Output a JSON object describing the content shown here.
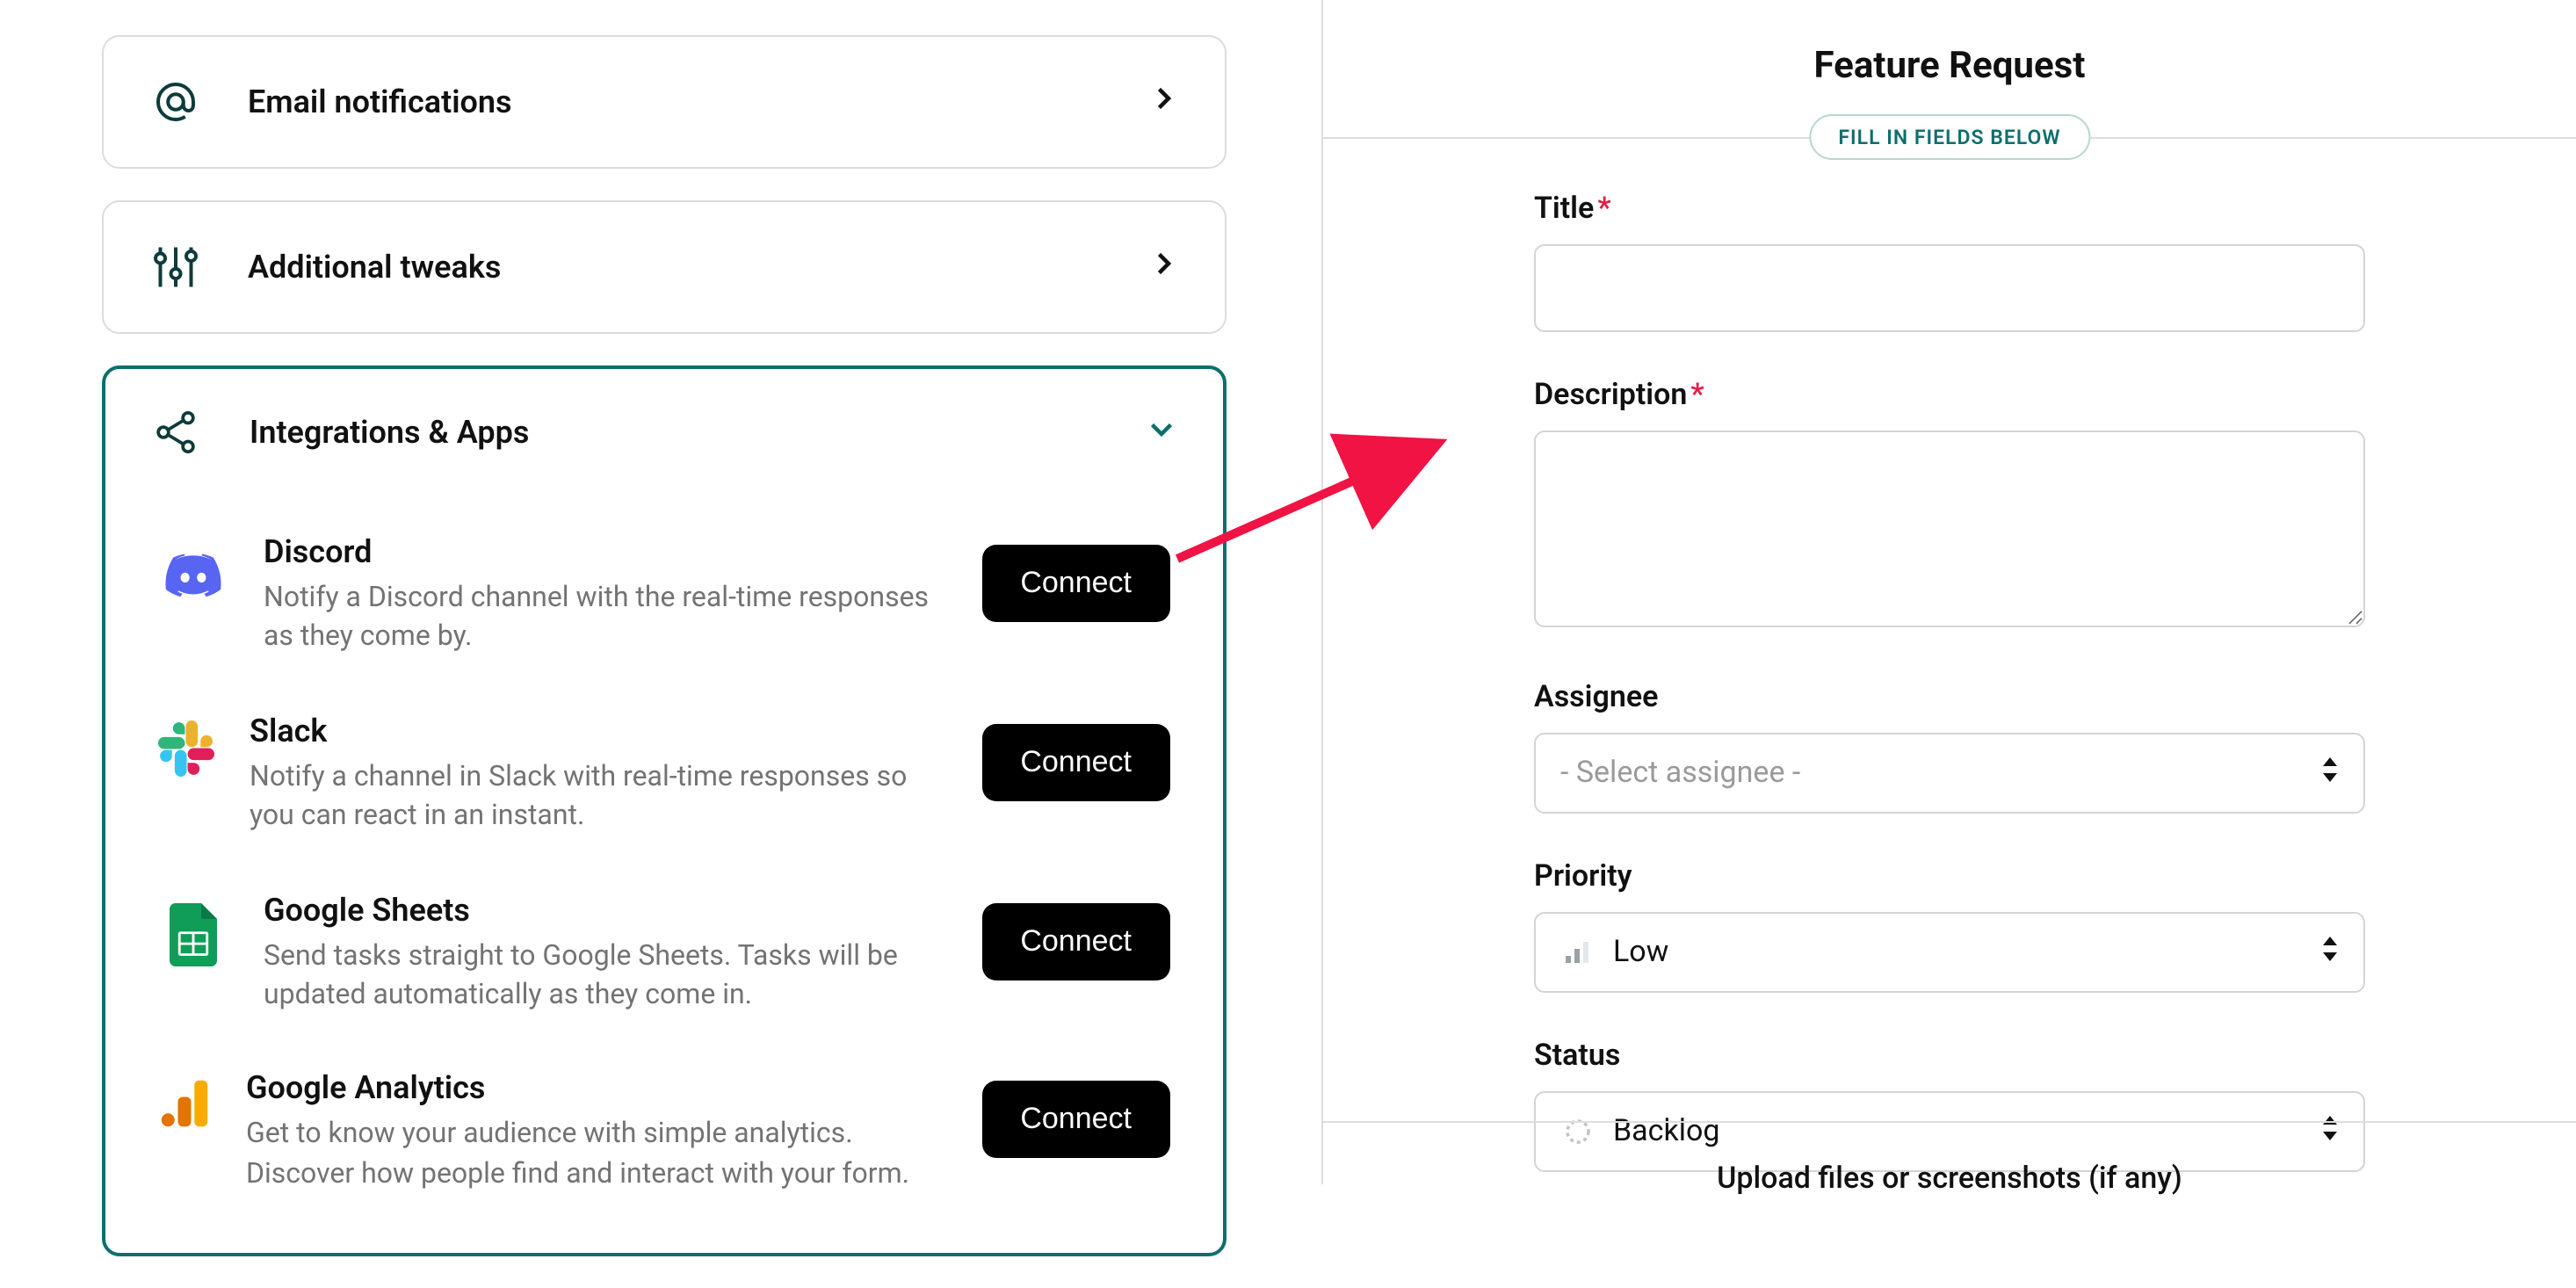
{
  "left": {
    "cards": {
      "email": {
        "title": "Email notifications"
      },
      "tweaks": {
        "title": "Additional tweaks"
      },
      "integrations": {
        "title": "Integrations & Apps"
      }
    },
    "integrations": [
      {
        "key": "discord",
        "title": "Discord",
        "desc": "Notify a Discord channel with the real-time responses as they come by.",
        "button": "Connect"
      },
      {
        "key": "slack",
        "title": "Slack",
        "desc": "Notify a channel in Slack with real-time responses so you can react in an instant.",
        "button": "Connect"
      },
      {
        "key": "sheets",
        "title": "Google Sheets",
        "desc": "Send tasks straight to Google Sheets. Tasks will be updated automatically as they come in.",
        "button": "Connect"
      },
      {
        "key": "analytics",
        "title": "Google Analytics",
        "desc": "Get to know your audience with simple analytics. Discover how people find and interact with your form.",
        "button": "Connect"
      }
    ]
  },
  "right": {
    "title": "Feature Request",
    "pill": "FILL IN FIELDS BELOW",
    "fields": {
      "title_label": "Title",
      "title_value": "",
      "desc_label": "Description",
      "desc_value": "",
      "assignee_label": "Assignee",
      "assignee_placeholder": "- Select assignee -",
      "priority_label": "Priority",
      "priority_value": "Low",
      "status_label": "Status",
      "status_value": "Backlog"
    },
    "upload_hint": "Upload files or screenshots (if any)"
  },
  "colors": {
    "accent_teal": "#0e6e6e",
    "annotation_red": "#f01343"
  }
}
